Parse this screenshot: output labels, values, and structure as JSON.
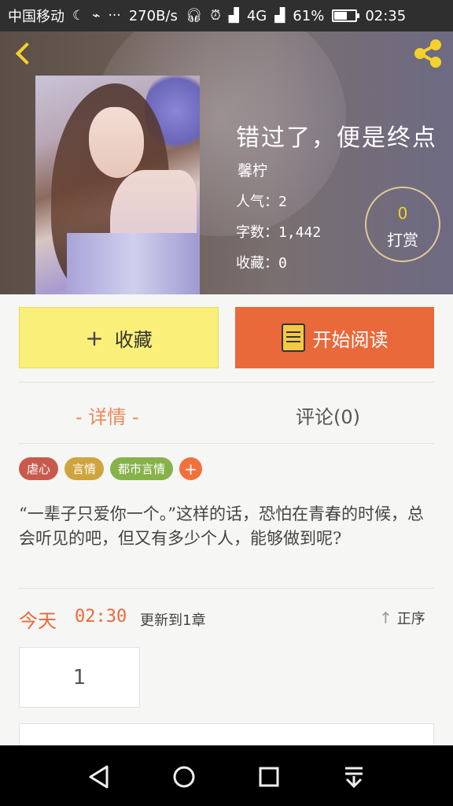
{
  "status_bar": {
    "carrier": "中国移动",
    "speed": "270B/s",
    "network": "4G",
    "battery_percent": "61%",
    "battery_level": 0.61,
    "time": "02:35"
  },
  "header": {
    "book_title": "错过了，便是终点",
    "author": "馨柠",
    "popularity": "人气：2",
    "word_count": "字数：1,442",
    "favorites": "收藏：0",
    "tip_count": "0",
    "tip_label": "打赏"
  },
  "actions": {
    "collect_label": "收藏",
    "read_label": "开始阅读"
  },
  "tabs": [
    {
      "label": "- 详情 -",
      "active": true
    },
    {
      "label": "评论(0)",
      "active": false
    }
  ],
  "tags": [
    {
      "label": "虐心",
      "color": "#c85a4c"
    },
    {
      "label": "言情",
      "color": "#cfa43e"
    },
    {
      "label": "都市言情",
      "color": "#86b24a"
    }
  ],
  "tag_add": "+",
  "description": "“一辈子只爱你一个。”这样的话，恐怕在青春的时候，总会听见的吧，但又有多少个人，能够做到呢?",
  "update": {
    "day": "今天",
    "time": "02:30",
    "text": "更新到1章",
    "order_label": "正序"
  },
  "chapters": [
    "1"
  ],
  "colors": {
    "accent": "#e9693b",
    "collect_bg": "#faef79",
    "icon_yellow": "#f5d12c"
  }
}
